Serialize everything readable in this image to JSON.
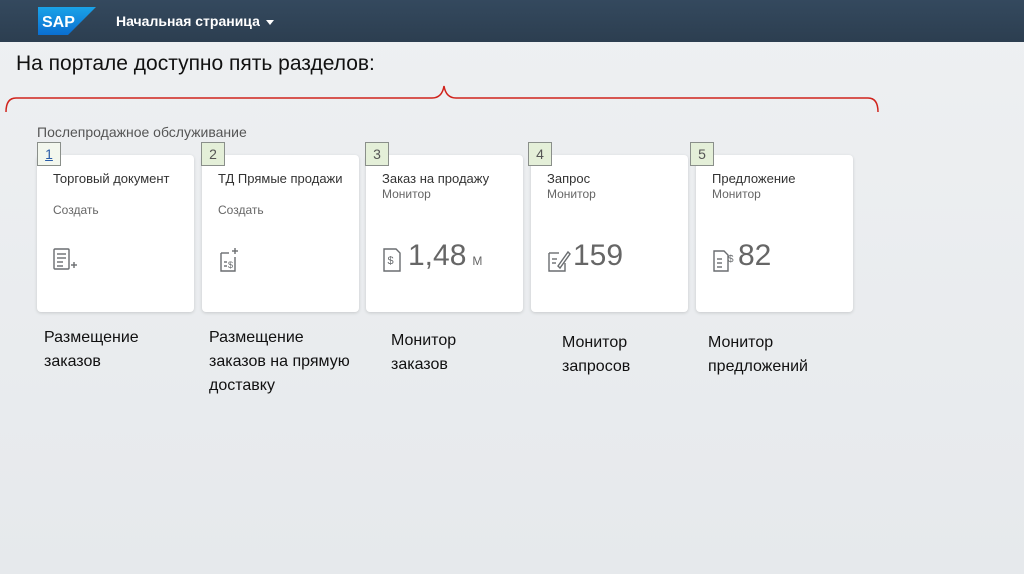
{
  "shell": {
    "logo_text": "SAP",
    "title": "Начальная страница"
  },
  "intro": "На портале доступно пять разделов:",
  "group_title": "Послепродажное обслуживание",
  "tiles": [
    {
      "badge": "1",
      "title": "Торговый документ",
      "subtitle": "Создать",
      "icon": "document-add-icon",
      "number": "",
      "unit": ""
    },
    {
      "badge": "2",
      "title": "ТД Прямые продажи",
      "subtitle": "Создать",
      "icon": "invoice-add-icon",
      "number": "",
      "unit": ""
    },
    {
      "badge": "3",
      "title": "Заказ на продажу",
      "subtitle": "Монитор",
      "icon": "sales-order-icon",
      "number": "1,48",
      "unit": "М"
    },
    {
      "badge": "4",
      "title": "Запрос",
      "subtitle": "Монитор",
      "icon": "request-edit-icon",
      "number": "159",
      "unit": ""
    },
    {
      "badge": "5",
      "title": "Предложение",
      "subtitle": "Монитор",
      "icon": "quotation-icon",
      "number": "82",
      "unit": ""
    }
  ],
  "captions": [
    "Размещение заказов",
    "Размещение заказов на прямую доставку",
    "Монитор заказов",
    "Монитор запросов",
    "Монитор предложений"
  ],
  "colors": {
    "shellbar": "#2c3e50",
    "bracket": "#d0231c",
    "badge_bg": "#e4efd8",
    "sap_blue": "#0a6ed1"
  }
}
